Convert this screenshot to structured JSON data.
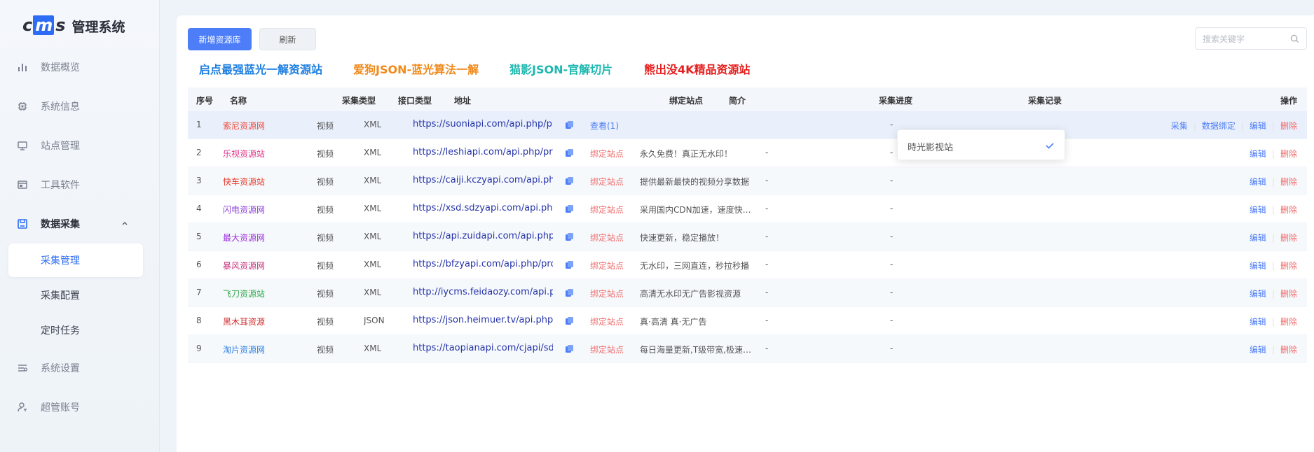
{
  "app": {
    "logo_part1": "c",
    "logo_part2": "m",
    "logo_part3": "s",
    "title": "管理系统"
  },
  "sidebar": {
    "items": [
      {
        "label": "数据概览",
        "icon": "bar-chart-icon"
      },
      {
        "label": "系统信息",
        "icon": "chip-icon"
      },
      {
        "label": "站点管理",
        "icon": "monitor-icon"
      },
      {
        "label": "工具软件",
        "icon": "window-icon"
      },
      {
        "label": "数据采集",
        "icon": "save-icon"
      },
      {
        "label": "系统设置",
        "icon": "settings-sliders-icon"
      },
      {
        "label": "超管账号",
        "icon": "user-key-icon"
      }
    ],
    "sub_items": [
      "采集管理",
      "采集配置",
      "定时任务"
    ],
    "active_sub": "采集管理"
  },
  "toolbar": {
    "add_label": "新增资源库",
    "refresh_label": "刷新",
    "search_placeholder": "搜索关键字"
  },
  "promos": [
    {
      "label": "启点最强蓝光一解资源站",
      "color": "#1e7fe0"
    },
    {
      "label": "爱狗JSON-蓝光算法一解",
      "color": "#f08a1c"
    },
    {
      "label": "猫影JSON-官解切片",
      "color": "#1cb8b0"
    },
    {
      "label": "熊出没4K精品资源站",
      "color": "#e61d1d"
    }
  ],
  "table": {
    "headers": [
      "序号",
      "名称",
      "采集类型",
      "接口类型",
      "地址",
      "绑定站点",
      "简介",
      "采集进度",
      "采集记录",
      "操作"
    ],
    "rows": [
      {
        "no": "1",
        "name": "索尼资源网",
        "name_color": "#f04a3a",
        "type": "视频",
        "api": "XML",
        "url": "https://suoniapi.com/api.php/provide/vod",
        "bind": "查看(1)",
        "bind_kind": "view",
        "desc": "",
        "progress": "",
        "record": "-",
        "ops": [
          "采集",
          "数据绑定",
          "编辑",
          "删除"
        ]
      },
      {
        "no": "2",
        "name": "乐视资源站",
        "name_color": "#e0338a",
        "type": "视频",
        "api": "XML",
        "url": "https://leshiapi.com/api.php/provide/vod/",
        "bind": "绑定站点",
        "bind_kind": "bind",
        "desc": "永久免费！真正无水印！",
        "progress": "-",
        "record": "-",
        "ops": [
          "编辑",
          "删除"
        ]
      },
      {
        "no": "3",
        "name": "快车资源站",
        "name_color": "#e63a2a",
        "type": "视频",
        "api": "XML",
        "url": "https://caiji.kczyapi.com/api.php/provide/",
        "bind": "绑定站点",
        "bind_kind": "bind",
        "desc": "提供最新最快的视频分享数据",
        "progress": "-",
        "record": "-",
        "ops": [
          "编辑",
          "删除"
        ]
      },
      {
        "no": "4",
        "name": "闪电资源网",
        "name_color": "#8a3fd6",
        "type": "视频",
        "api": "XML",
        "url": "https://xsd.sdzyapi.com/api.php/provide/",
        "bind": "绑定站点",
        "bind_kind": "bind",
        "desc": "采用国内CDN加速，速度快到无...",
        "progress": "-",
        "record": "-",
        "ops": [
          "编辑",
          "删除"
        ]
      },
      {
        "no": "5",
        "name": "最大资源网",
        "name_color": "#9a2fd8",
        "type": "视频",
        "api": "XML",
        "url": "https://api.zuidapi.com/api.php/provide/v",
        "bind": "绑定站点",
        "bind_kind": "bind",
        "desc": "快速更新，稳定播放！",
        "progress": "-",
        "record": "-",
        "ops": [
          "编辑",
          "删除"
        ]
      },
      {
        "no": "6",
        "name": "暴风资源网",
        "name_color": "#c2307a",
        "type": "视频",
        "api": "XML",
        "url": "https://bfzyapi.com/api.php/provide/vod/",
        "bind": "绑定站点",
        "bind_kind": "bind",
        "desc": "无水印，三网直连，秒拉秒播",
        "progress": "-",
        "record": "-",
        "ops": [
          "编辑",
          "删除"
        ]
      },
      {
        "no": "7",
        "name": "飞刀资源站",
        "name_color": "#2fa84a",
        "type": "视频",
        "api": "XML",
        "url": "http://iycms.feidaozy.com/api.php/provid",
        "bind": "绑定站点",
        "bind_kind": "bind",
        "desc": "高清无水印无广告影视资源",
        "progress": "-",
        "record": "-",
        "ops": [
          "编辑",
          "删除"
        ]
      },
      {
        "no": "8",
        "name": "黑木耳资源",
        "name_color": "#d02a2a",
        "type": "视频",
        "api": "JSON",
        "url": "https://json.heimuer.tv/api.php/provide/v",
        "bind": "绑定站点",
        "bind_kind": "bind",
        "desc": "真·高清 真·无广告",
        "progress": "-",
        "record": "-",
        "ops": [
          "编辑",
          "删除"
        ]
      },
      {
        "no": "9",
        "name": "淘片资源网",
        "name_color": "#2a7fe0",
        "type": "视频",
        "api": "XML",
        "url": "https://taopianapi.com/cjapi/sda/vod/xml",
        "bind": "绑定站点",
        "bind_kind": "bind",
        "desc": "每日海量更新,T级带宽,极速播放",
        "progress": "-",
        "record": "-",
        "ops": [
          "编辑",
          "删除"
        ]
      }
    ]
  },
  "dropdown": {
    "option": "時光影视站"
  }
}
